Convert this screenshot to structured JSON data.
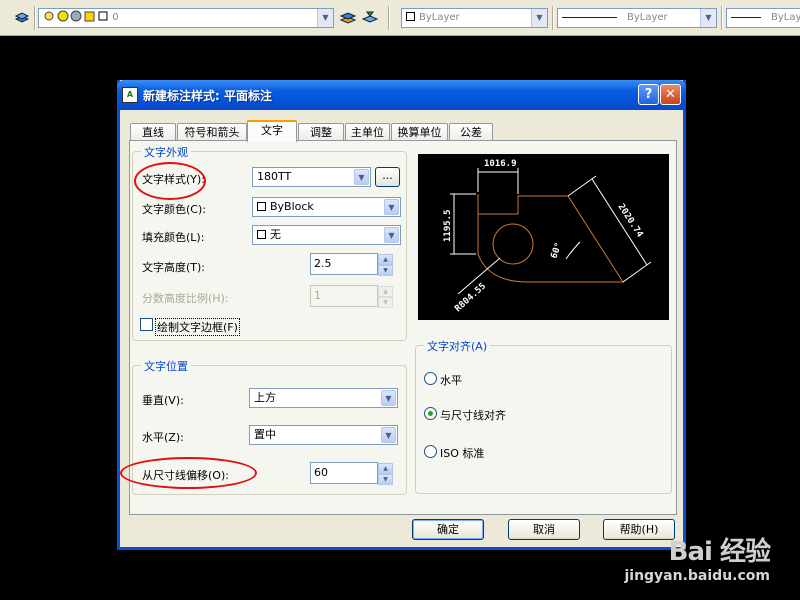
{
  "toolbar": {
    "layer_value": "0",
    "color_value": "ByLayer",
    "linetype_value": "ByLayer",
    "lineweight_value": "ByLayer"
  },
  "dialog": {
    "title": "新建标注样式: 平面标注",
    "help_glyph": "?",
    "close_glyph": "✕",
    "tabs": [
      "直线",
      "符号和箭头",
      "文字",
      "调整",
      "主单位",
      "换算单位",
      "公差"
    ],
    "active_tab": "文字",
    "text_appearance": {
      "group_label": "文字外观",
      "text_style_label": "文字样式(Y):",
      "text_style_value": "180TT",
      "browse_label": "...",
      "text_color_label": "文字颜色(C):",
      "text_color_value": "ByBlock",
      "fill_color_label": "填充颜色(L):",
      "fill_color_value": "无",
      "text_height_label": "文字高度(T):",
      "text_height_value": "2.5",
      "fraction_scale_label": "分数高度比例(H):",
      "fraction_scale_value": "1",
      "draw_frame_label": "绘制文字边框(F)"
    },
    "text_placement": {
      "group_label": "文字位置",
      "vertical_label": "垂直(V):",
      "vertical_value": "上方",
      "horizontal_label": "水平(Z):",
      "horizontal_value": "置中",
      "offset_label": "从尺寸线偏移(O):",
      "offset_value": "60"
    },
    "text_alignment": {
      "group_label": "文字对齐(A)",
      "options": [
        "水平",
        "与尺寸线对齐",
        "ISO 标准"
      ],
      "selected_index": 1
    },
    "preview": {
      "dim_top": "1016.9",
      "dim_left": "1195.5",
      "dim_slant": "2020.74",
      "dim_angle": "60°",
      "dim_radius": "R804.55"
    },
    "buttons": {
      "ok": "确定",
      "cancel": "取消",
      "help": "帮助(H)"
    }
  },
  "watermark": {
    "logo": "Bai 经验",
    "url": "jingyan.baidu.com"
  },
  "colors": {
    "annotation": "#e01010",
    "title_bar": "#0a5fe0",
    "preview_bg": "#000000",
    "dim_white": "#ffffff",
    "shape_orange": "#c87a30"
  }
}
